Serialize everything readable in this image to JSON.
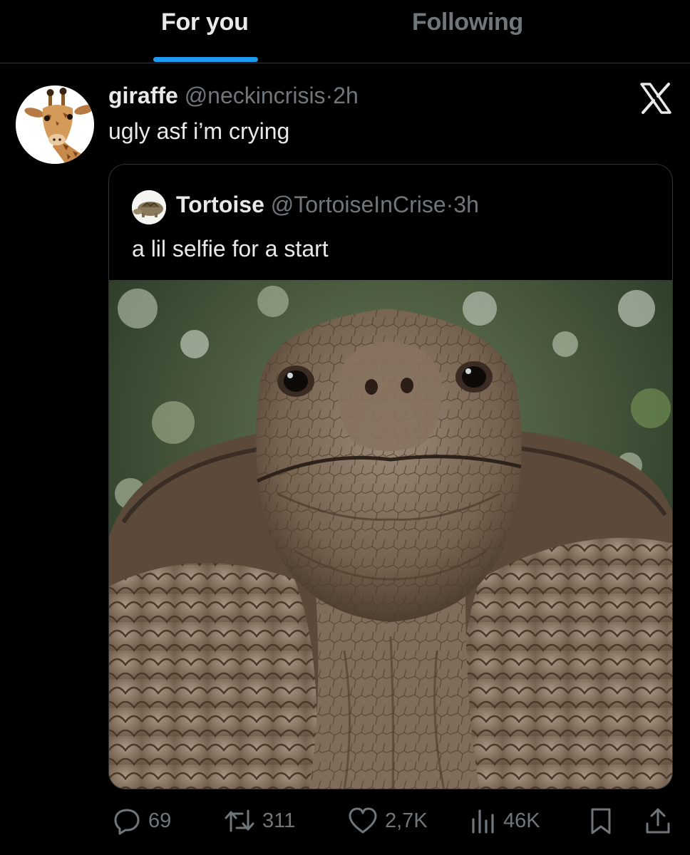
{
  "tabs": {
    "active": "For you",
    "inactive": "Following"
  },
  "tweet": {
    "name": "giraffe",
    "handle": "@neckincrisis",
    "separator": "·",
    "time": "2h",
    "text": "ugly asf i’m crying",
    "avatar_icon": "giraffe-avatar",
    "platform_icon": "x-logo-icon"
  },
  "quote": {
    "name": "Tortoise",
    "handle": "@TortoiseInCrise",
    "separator": "·",
    "time": "3h",
    "text": "a lil selfie for a start",
    "avatar_icon": "tortoise-avatar",
    "media_icon": "tortoise-selfie-photo"
  },
  "actions": {
    "replies": "69",
    "reposts": "311",
    "likes": "2,7K",
    "views": "46K"
  },
  "colors": {
    "background": "#000000",
    "text": "#e7e9ea",
    "muted": "#71767b",
    "accent": "#1d9bf0",
    "border": "#2f3336"
  }
}
